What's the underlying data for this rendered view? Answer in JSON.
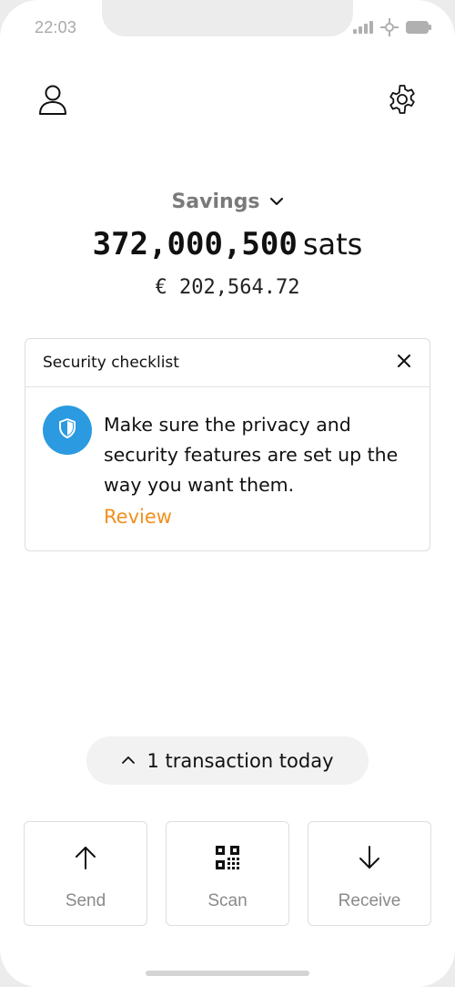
{
  "status_bar": {
    "time": "22:03",
    "icons": [
      "signal-icon",
      "network-icon",
      "battery-icon"
    ]
  },
  "header": {
    "profile_icon": "user-icon",
    "settings_icon": "gear-icon"
  },
  "wallet": {
    "name": "Savings",
    "balance": "372,000,500",
    "unit": "sats",
    "fiat": "€ 202,564.72"
  },
  "security_card": {
    "title": "Security checklist",
    "message": "Make sure the privacy and security features are set up the way you want them.",
    "link_label": "Review",
    "icon": "shield-icon"
  },
  "transactions": {
    "label": "1 transaction today"
  },
  "actions": {
    "send_label": "Send",
    "scan_label": "Scan",
    "receive_label": "Receive"
  },
  "colors": {
    "accent": "#f0901e",
    "shield_bg": "#2b9ae0",
    "muted_text": "#8a8a8a"
  }
}
